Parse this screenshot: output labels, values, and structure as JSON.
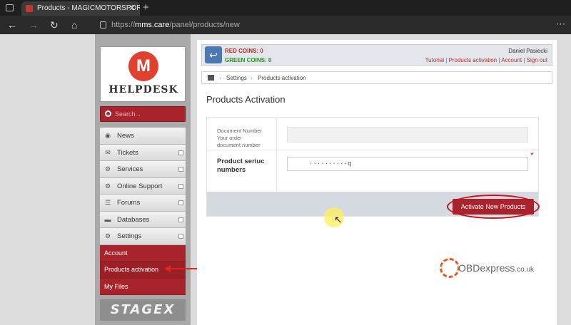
{
  "browser": {
    "tab_title": "Products - MAGICMOTORSPORT",
    "tab_close": "✕",
    "new_tab": "+",
    "url_scheme": "https://",
    "url_host": "mms.care",
    "url_path": "/panel/products/new",
    "url_icon": "lock-icon"
  },
  "sidebar": {
    "logo_letter": "M",
    "logo_text": "HELPDESK",
    "search_placeholder": "Search...",
    "menu": [
      {
        "label": "News",
        "icon": "rss-icon"
      },
      {
        "label": "Tickets",
        "icon": "envelope-icon"
      },
      {
        "label": "Services",
        "icon": "gear-icon"
      },
      {
        "label": "Online Support",
        "icon": "gear-icon"
      },
      {
        "label": "Forums",
        "icon": "forum-icon"
      },
      {
        "label": "Databases",
        "icon": "folder-icon"
      },
      {
        "label": "Settings",
        "icon": "gear-icon"
      }
    ],
    "submenu": [
      "Account",
      "Products activation",
      "My Files"
    ],
    "footer_logo": "STAGEX"
  },
  "header": {
    "red_coins": "RED COINS: 0",
    "green_coins": "GREEN COINS: 0",
    "user_name": "Daniel Pasiecki",
    "links": [
      "Tutorial",
      "Products activation",
      "Account",
      "Sign out"
    ],
    "link_sep": " | "
  },
  "breadcrumb": {
    "items": [
      "Settings",
      "Products activation"
    ],
    "sep": "›"
  },
  "page_title": "Products Activation",
  "form": {
    "doc_number_label_1": "Document Number",
    "doc_number_label_2": "Your order",
    "doc_number_label_3": "document number",
    "doc_number_value": "",
    "serial_label_1": "Product seriuc",
    "serial_label_2": "numbers",
    "serial_value": "··········q",
    "required_mark": "*",
    "submit_label": "Activate New Products"
  },
  "watermark": {
    "brand": "OBDexpress",
    "suffix": ".co.uk"
  },
  "colors": {
    "accent": "#a8232c",
    "link": "#b23030",
    "red_coins": "#c0271e",
    "green_coins": "#2c8a2c"
  }
}
